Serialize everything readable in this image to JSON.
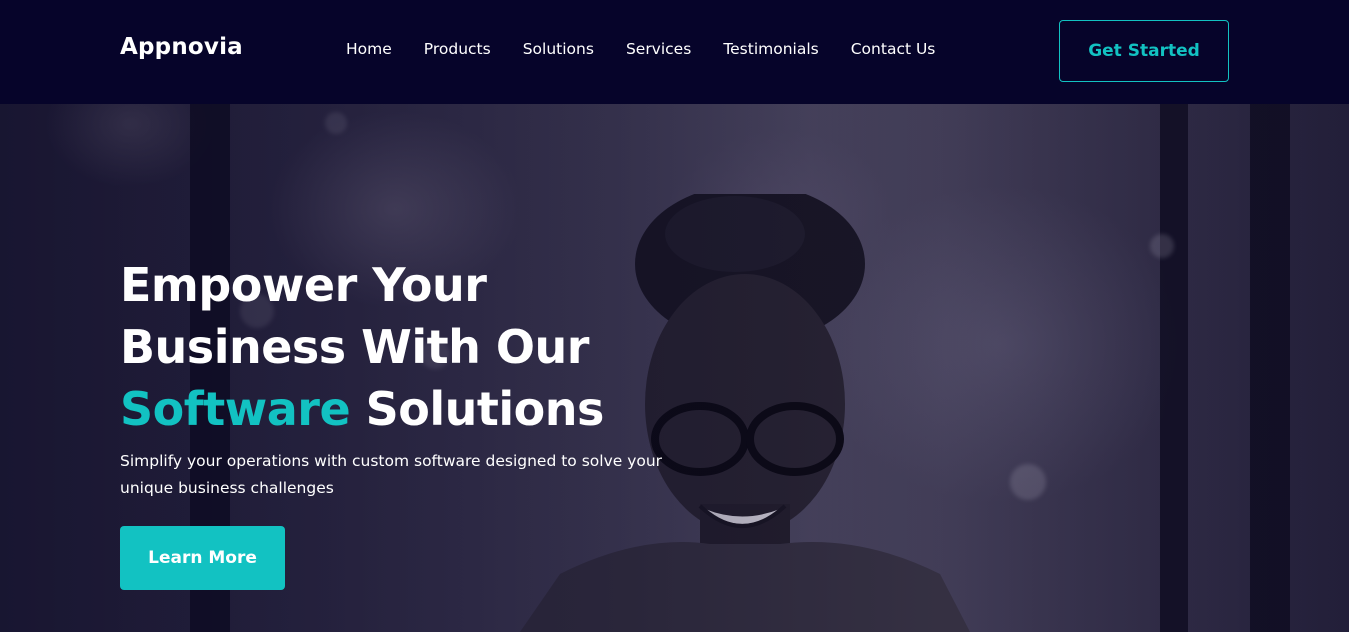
{
  "brand": {
    "name": "Appnovia"
  },
  "nav": {
    "links": [
      "Home",
      "Products",
      "Solutions",
      "Services",
      "Testimonials",
      "Contact Us"
    ],
    "cta_label": "Get Started"
  },
  "hero": {
    "title_line1": "Empower Your",
    "title_line2": "Business With Our",
    "title_accent": "Software",
    "title_end": "Solutions",
    "subtitle": "Simplify your operations with custom software designed to solve your unique business challenges",
    "button_label": "Learn More"
  },
  "colors": {
    "accent": "#12c2c2",
    "header_bg": "#06042a",
    "text": "#ffffff"
  }
}
